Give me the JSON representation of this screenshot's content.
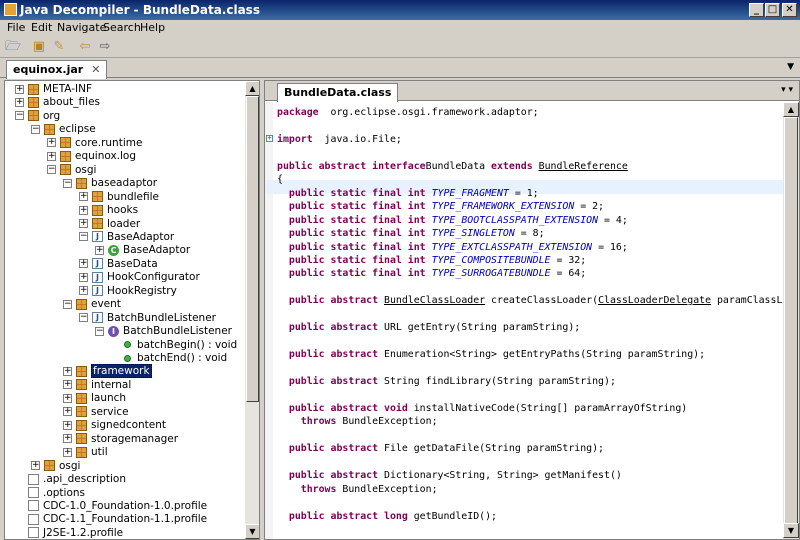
{
  "window": {
    "title": "Java Decompiler - BundleData.class",
    "min": "_",
    "max": "□",
    "close": "✕"
  },
  "menu": [
    "File",
    "Edit",
    "Navigate",
    "Search",
    "Help"
  ],
  "jar_tab": {
    "label": "equinox.jar",
    "close": "✕"
  },
  "editor_tab": {
    "label": "BundleData.class",
    "controls": "▾  ▾"
  },
  "tree": [
    {
      "label": "META-INF",
      "exp": "+",
      "icon": "pkg",
      "level": 0
    },
    {
      "label": "about_files",
      "exp": "+",
      "icon": "pkg",
      "level": 0
    },
    {
      "label": "org",
      "exp": "−",
      "icon": "pkg",
      "level": 0
    },
    {
      "label": "eclipse",
      "exp": "−",
      "icon": "pkg",
      "level": 1
    },
    {
      "label": "core.runtime",
      "exp": "+",
      "icon": "pkg",
      "level": 2
    },
    {
      "label": "equinox.log",
      "exp": "+",
      "icon": "pkg",
      "level": 2
    },
    {
      "label": "osgi",
      "exp": "−",
      "icon": "pkg",
      "level": 2
    },
    {
      "label": "baseadaptor",
      "exp": "−",
      "icon": "pkg",
      "level": 3
    },
    {
      "label": "bundlefile",
      "exp": "+",
      "icon": "pkg",
      "level": 4
    },
    {
      "label": "hooks",
      "exp": "+",
      "icon": "pkg",
      "level": 4
    },
    {
      "label": "loader",
      "exp": "+",
      "icon": "pkg",
      "level": 4
    },
    {
      "label": "BaseAdaptor",
      "exp": "−",
      "icon": "cls",
      "level": 4
    },
    {
      "label": "BaseAdaptor",
      "exp": "+",
      "icon": "cgr",
      "level": 5
    },
    {
      "label": "BaseData",
      "exp": "+",
      "icon": "cls",
      "level": 4
    },
    {
      "label": "HookConfigurator",
      "exp": "+",
      "icon": "cls",
      "level": 4
    },
    {
      "label": "HookRegistry",
      "exp": "+",
      "icon": "cls",
      "level": 4
    },
    {
      "label": "event",
      "exp": "−",
      "icon": "pkg",
      "level": 3
    },
    {
      "label": "BatchBundleListener",
      "exp": "−",
      "icon": "cls",
      "level": 4
    },
    {
      "label": "BatchBundleListener",
      "exp": "−",
      "icon": "ifc",
      "level": 5
    },
    {
      "label": "batchBegin() : void",
      "exp": "",
      "icon": "mtd",
      "level": 6
    },
    {
      "label": "batchEnd() : void",
      "exp": "",
      "icon": "mtd",
      "level": 6
    },
    {
      "label": "framework",
      "exp": "+",
      "icon": "pkg",
      "level": 3,
      "selected": true
    },
    {
      "label": "internal",
      "exp": "+",
      "icon": "pkg",
      "level": 3
    },
    {
      "label": "launch",
      "exp": "+",
      "icon": "pkg",
      "level": 3
    },
    {
      "label": "service",
      "exp": "+",
      "icon": "pkg",
      "level": 3
    },
    {
      "label": "signedcontent",
      "exp": "+",
      "icon": "pkg",
      "level": 3
    },
    {
      "label": "storagemanager",
      "exp": "+",
      "icon": "pkg",
      "level": 3
    },
    {
      "label": "util",
      "exp": "+",
      "icon": "pkg",
      "level": 3
    },
    {
      "label": "osgi",
      "exp": "+",
      "icon": "pkg",
      "level": 1
    },
    {
      "label": ".api_description",
      "exp": "",
      "icon": "fld",
      "level": 0
    },
    {
      "label": ".options",
      "exp": "",
      "icon": "fld",
      "level": 0
    },
    {
      "label": "CDC-1.0_Foundation-1.0.profile",
      "exp": "",
      "icon": "fld",
      "level": 0
    },
    {
      "label": "CDC-1.1_Foundation-1.1.profile",
      "exp": "",
      "icon": "fld",
      "level": 0
    },
    {
      "label": "J2SE-1.2.profile",
      "exp": "",
      "icon": "fld",
      "level": 0
    }
  ],
  "code": [
    {
      "row": 0,
      "parts": [
        [
          "kw",
          "package"
        ],
        [
          "",
          "  org.eclipse.osgi.framework.adaptor;"
        ]
      ]
    },
    {
      "row": 2,
      "parts": [
        [
          "kw",
          "import"
        ],
        [
          "",
          "  java.io.File;"
        ]
      ]
    },
    {
      "row": 4,
      "parts": [
        [
          "kw",
          "public abstract interface"
        ],
        [
          "",
          ""
        ],
        [
          "",
          "BundleData "
        ],
        [
          "kw",
          "extends"
        ],
        [
          "",
          " "
        ],
        [
          "ul",
          "BundleReference"
        ]
      ]
    },
    {
      "row": 5,
      "parts": [
        [
          "",
          "{"
        ]
      ]
    },
    {
      "row": 6,
      "parts": [
        [
          "kw",
          "  public static final int"
        ],
        [
          "",
          " "
        ],
        [
          "ft",
          "TYPE_FRAGMENT"
        ],
        [
          "",
          " = 1;"
        ]
      ]
    },
    {
      "row": 7,
      "parts": [
        [
          "kw",
          "  public static final int"
        ],
        [
          "",
          " "
        ],
        [
          "ft",
          "TYPE_FRAMEWORK_EXTENSION"
        ],
        [
          "",
          " = 2;"
        ]
      ]
    },
    {
      "row": 8,
      "parts": [
        [
          "kw",
          "  public static final int"
        ],
        [
          "",
          " "
        ],
        [
          "ft",
          "TYPE_BOOTCLASSPATH_EXTENSION"
        ],
        [
          "",
          " = 4;"
        ]
      ]
    },
    {
      "row": 9,
      "parts": [
        [
          "kw",
          "  public static final int"
        ],
        [
          "",
          " "
        ],
        [
          "ft",
          "TYPE_SINGLETON"
        ],
        [
          "",
          " = 8;"
        ]
      ]
    },
    {
      "row": 10,
      "parts": [
        [
          "kw",
          "  public static final int"
        ],
        [
          "",
          " "
        ],
        [
          "ft",
          "TYPE_EXTCLASSPATH_EXTENSION"
        ],
        [
          "",
          " = 16;"
        ]
      ]
    },
    {
      "row": 11,
      "parts": [
        [
          "kw",
          "  public static final int"
        ],
        [
          "",
          " "
        ],
        [
          "ft",
          "TYPE_COMPOSITEBUNDLE"
        ],
        [
          "",
          " = 32;"
        ]
      ]
    },
    {
      "row": 12,
      "parts": [
        [
          "kw",
          "  public static final int"
        ],
        [
          "",
          " "
        ],
        [
          "ft",
          "TYPE_SURROGATEBUNDLE"
        ],
        [
          "",
          " = 64;"
        ]
      ]
    },
    {
      "row": 14,
      "parts": [
        [
          "kw",
          "  public abstract"
        ],
        [
          "",
          " "
        ],
        [
          "ul",
          "BundleClassLoader"
        ],
        [
          "",
          " createClassLoader("
        ],
        [
          "ul",
          "ClassLoaderDelegate"
        ],
        [
          "",
          " paramClassL"
        ]
      ]
    },
    {
      "row": 16,
      "parts": [
        [
          "kw",
          "  public abstract"
        ],
        [
          "",
          " URL getEntry(String paramString);"
        ]
      ]
    },
    {
      "row": 18,
      "parts": [
        [
          "kw",
          "  public abstract"
        ],
        [
          "",
          " Enumeration<String> getEntryPaths(String paramString);"
        ]
      ]
    },
    {
      "row": 20,
      "parts": [
        [
          "kw",
          "  public abstract"
        ],
        [
          "",
          " String findLibrary(String paramString);"
        ]
      ]
    },
    {
      "row": 22,
      "parts": [
        [
          "kw",
          "  public abstract void"
        ],
        [
          "",
          " installNativeCode(String[] paramArrayOfString)"
        ]
      ]
    },
    {
      "row": 23,
      "parts": [
        [
          "kw",
          "    throws"
        ],
        [
          "",
          " BundleException;"
        ]
      ]
    },
    {
      "row": 25,
      "parts": [
        [
          "kw",
          "  public abstract"
        ],
        [
          "",
          " File getDataFile(String paramString);"
        ]
      ]
    },
    {
      "row": 27,
      "parts": [
        [
          "kw",
          "  public abstract"
        ],
        [
          "",
          " Dictionary<String, String> getManifest()"
        ]
      ]
    },
    {
      "row": 28,
      "parts": [
        [
          "kw",
          "    throws"
        ],
        [
          "",
          " BundleException;"
        ]
      ]
    },
    {
      "row": 30,
      "parts": [
        [
          "kw",
          "  public abstract long"
        ],
        [
          "",
          " getBundleID();"
        ]
      ]
    }
  ]
}
